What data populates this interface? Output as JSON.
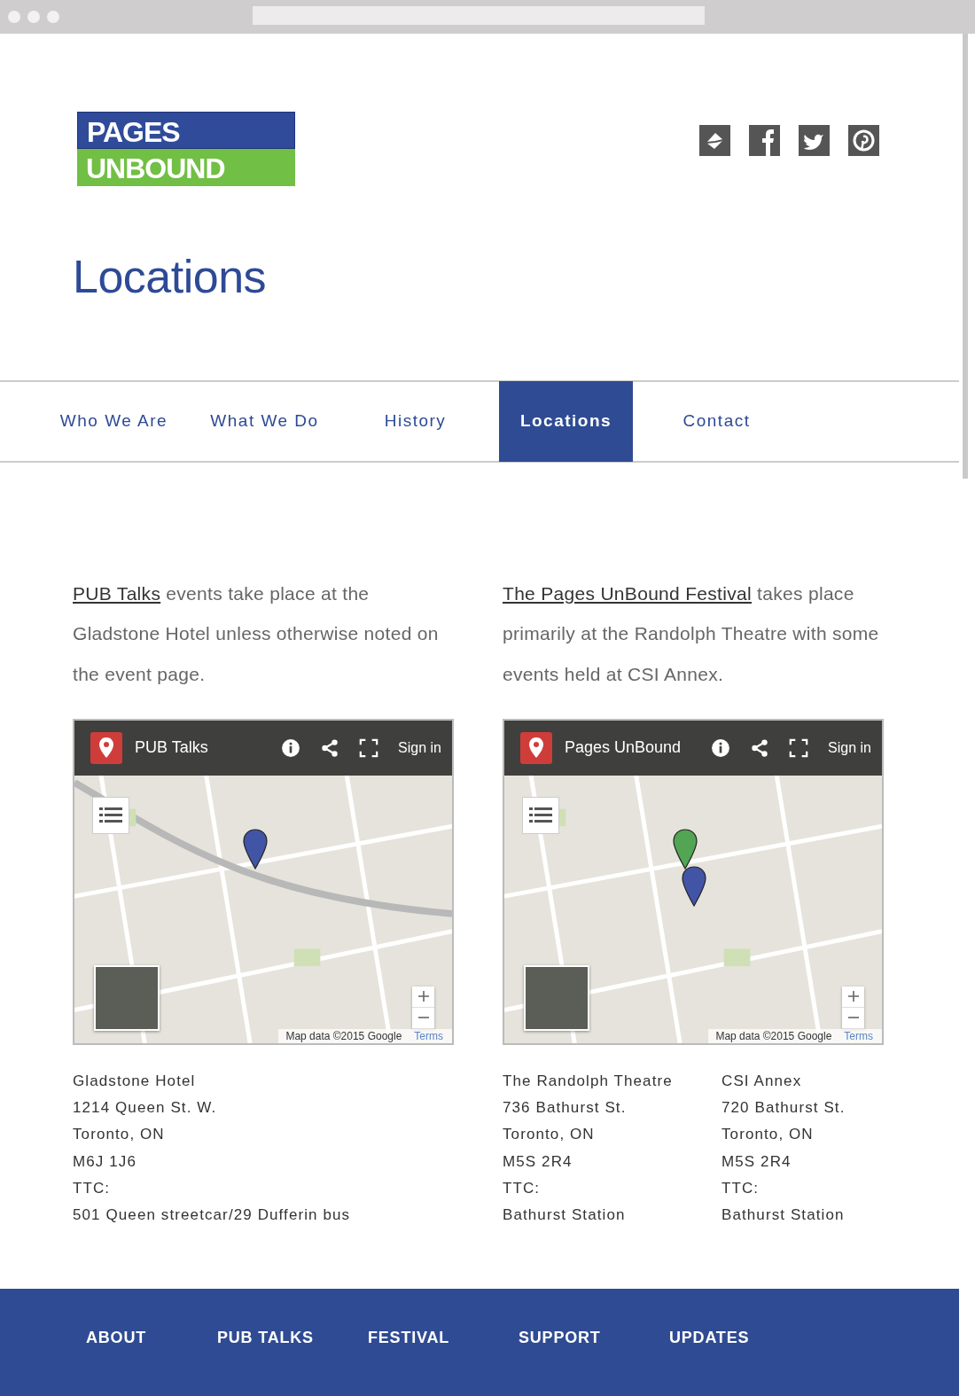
{
  "logo": {
    "line_1": "PAGES",
    "line_2": "UNBOUND"
  },
  "page_title": "Locations",
  "nav": [
    {
      "label": "Who We Are",
      "selected": false
    },
    {
      "label": "What We Do",
      "selected": false
    },
    {
      "label": "History",
      "selected": false
    },
    {
      "label": "Locations",
      "selected": true
    },
    {
      "label": "Contact",
      "selected": false
    }
  ],
  "columns": [
    {
      "intro": {
        "link": "PUB Talks",
        "text": " events take place at the Gladstone Hotel unless otherwise noted on the event page."
      },
      "map": {
        "title": "PUB Talks",
        "sign_in": "Sign in",
        "attribution": "Map data ©2015 Google",
        "terms": "Terms",
        "pins": [
          {
            "color": "#4254a6"
          }
        ]
      },
      "addresses": [
        [
          "Gladstone Hotel",
          "1214 Queen St. W.",
          "Toronto, ON",
          "M6J 1J6",
          "TTC:",
          "501 Queen streetcar/29 Dufferin bus"
        ]
      ]
    },
    {
      "intro": {
        "link": "The Pages UnBound Festival",
        "text": " takes place primarily at the Randolph Theatre with some events held at CSI Annex."
      },
      "map": {
        "title": "Pages UnBound",
        "sign_in": "Sign in",
        "attribution": "Map data ©2015 Google",
        "terms": "Terms",
        "pins": [
          {
            "color": "#52a552"
          },
          {
            "color": "#4254a6"
          }
        ]
      },
      "addresses": [
        [
          "The Randolph Theatre",
          "736 Bathurst St.",
          "Toronto, ON",
          "M5S 2R4",
          "TTC:",
          "Bathurst Station"
        ],
        [
          "CSI Annex",
          "720 Bathurst St.",
          "Toronto, ON",
          "M5S 2R4",
          "TTC:",
          "Bathurst Station"
        ]
      ]
    }
  ],
  "footer": [
    "ABOUT",
    "PUB TALKS",
    "FESTIVAL",
    "SUPPORT",
    "UPDATES"
  ]
}
